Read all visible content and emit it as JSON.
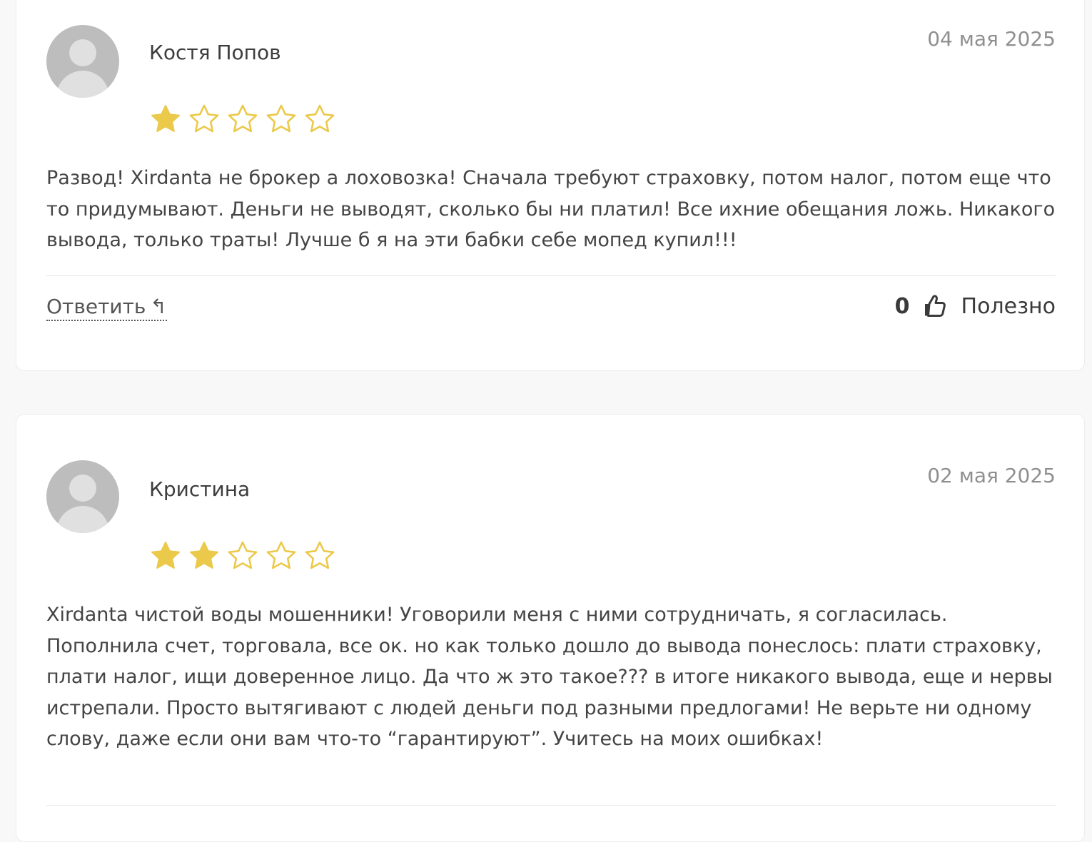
{
  "reviews": [
    {
      "author": "Костя Попов",
      "date": "04 мая 2025",
      "rating": 1,
      "max_rating": 5,
      "text": "Развод! Xirdanta не брокер а лоховозка! Сначала требуют страховку, потом налог, потом еще что то придумывают. Деньги не выводят, сколько бы ни платил! Все ихние обещания ложь. Никакого вывода, только траты! Лучше б я на эти бабки себе мопед купил!!!",
      "reply_label": "Ответить",
      "useful_count": "0",
      "useful_label": "Полезно"
    },
    {
      "author": "Кристина",
      "date": "02 мая 2025",
      "rating": 2,
      "max_rating": 5,
      "text": "Xirdanta чистой воды мошенники! Уговорили меня с ними сотрудничать, я согласилась. Пополнила счет, торговала, все ок. но как только дошло до вывода понеслось: плати страховку, плати налог, ищи доверенное лицо. Да что ж это такое??? в итоге никакого вывода, еще и нервы истрепали. Просто вытягивают с людей деньги под разными предлогами! Не верьте ни одному слову, даже если они вам что-то “гарантируют”. Учитесь на моих ошибках!"
    }
  ],
  "colors": {
    "star_filled": "#EBC94A",
    "star_empty_stroke": "#EBC94A",
    "avatar_bg": "#BDBDBD",
    "date_text": "#8F8F8F"
  },
  "icons": {
    "reply": "reply-arrow-icon",
    "useful": "thumbs-up-icon",
    "star": "star-icon",
    "avatar": "user-avatar-icon"
  }
}
